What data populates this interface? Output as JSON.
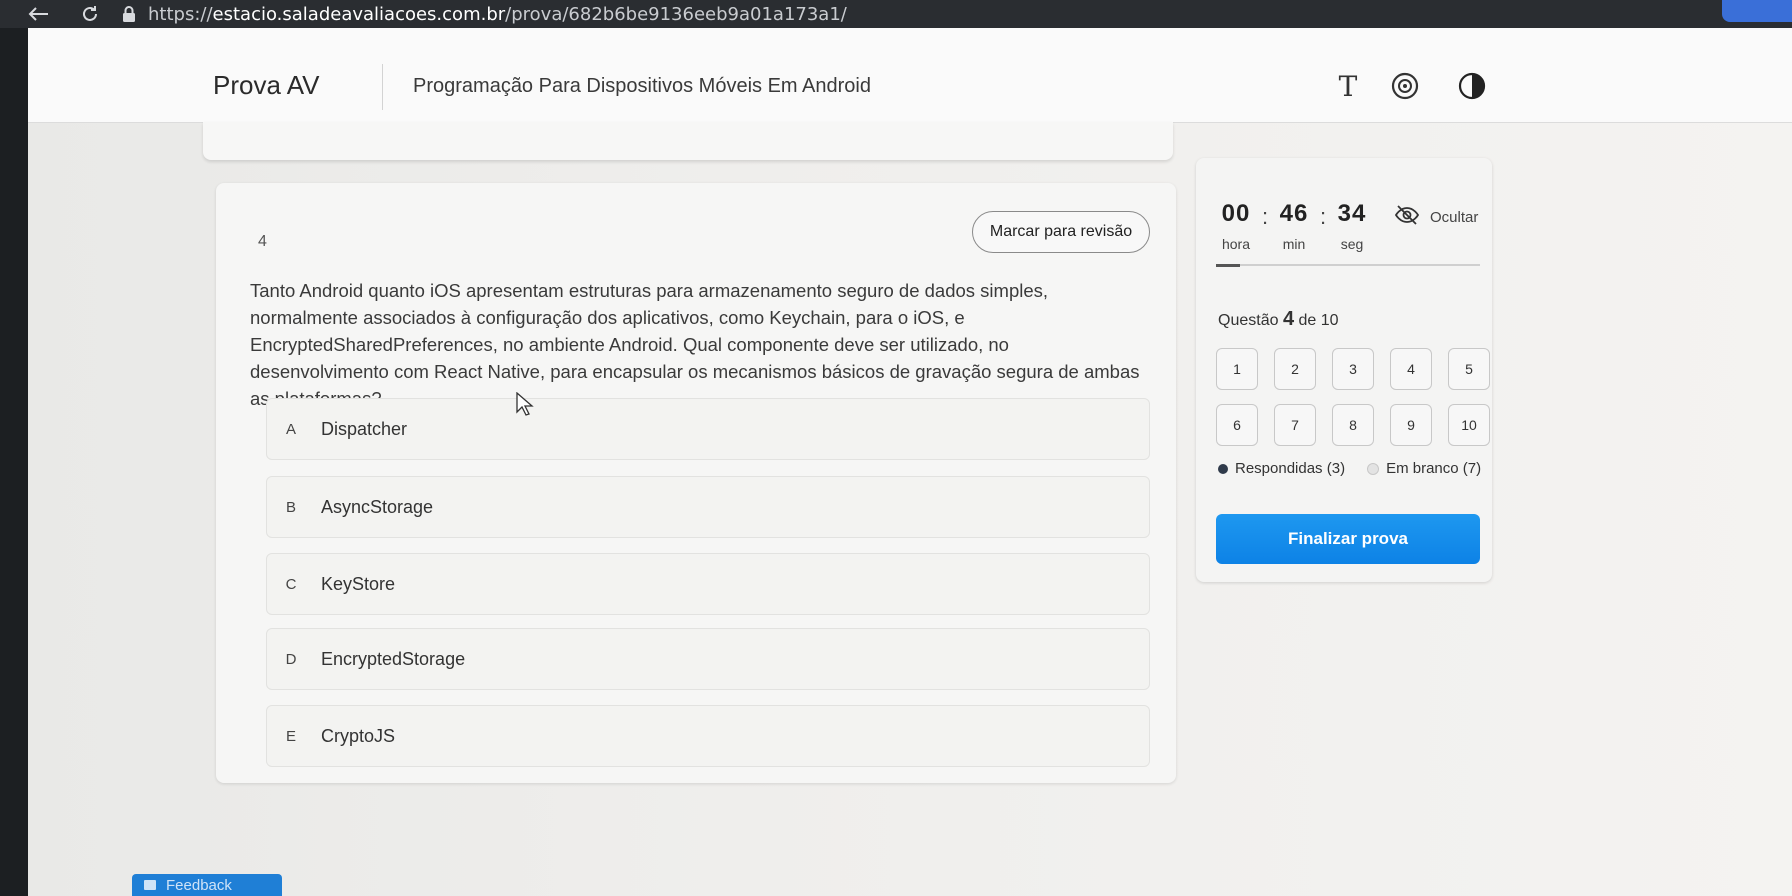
{
  "browser": {
    "url_prefix": "https://",
    "url_domain": "estacio.saladeavaliacoes.com.br",
    "url_path": "/prova/682b6be9136eeb9a01a173a1/",
    "icons": [
      "back-icon",
      "reload-icon",
      "lock-icon"
    ]
  },
  "header": {
    "exam_title": "Prova AV",
    "course_title": "Programação Para Dispositivos Móveis Em Android",
    "font_tool": "T",
    "icons": [
      "font-size-icon",
      "accessibility-icon",
      "contrast-icon"
    ]
  },
  "question": {
    "number": "4",
    "review_label": "Marcar para revisão",
    "text": "Tanto Android quanto iOS apresentam estruturas para armazenamento seguro de dados simples, normalmente associados à configuração dos aplicativos, como Keychain, para o iOS, e EncryptedSharedPreferences, no ambiente Android. Qual componente deve ser utilizado, no desenvolvimento com React Native, para encapsular os mecanismos básicos de gravação segura de ambas as plataformas?",
    "options": [
      {
        "letter": "A",
        "text": "Dispatcher"
      },
      {
        "letter": "B",
        "text": "AsyncStorage"
      },
      {
        "letter": "C",
        "text": "KeyStore"
      },
      {
        "letter": "D",
        "text": "EncryptedStorage"
      },
      {
        "letter": "E",
        "text": "CryptoJS"
      }
    ]
  },
  "timer": {
    "hours": "00",
    "minutes": "46",
    "seconds": "34",
    "hours_label": "hora",
    "minutes_label": "min",
    "seconds_label": "seg",
    "separator": ":",
    "hide_label": "Ocultar"
  },
  "navigation": {
    "progress_prefix": "Questão",
    "current": "4",
    "progress_suffix": "de 10",
    "questions": [
      "1",
      "2",
      "3",
      "4",
      "5",
      "6",
      "7",
      "8",
      "9",
      "10"
    ],
    "answered_label": "Respondidas (3)",
    "blank_label": "Em branco (7)",
    "finish_label": "Finalizar prova"
  },
  "footer": {
    "feedback_label": "Feedback"
  },
  "colors": {
    "primary": "#1e90ee",
    "answered_dot": "#2f3a4a",
    "feedback_tab": "#1f7fd6"
  }
}
